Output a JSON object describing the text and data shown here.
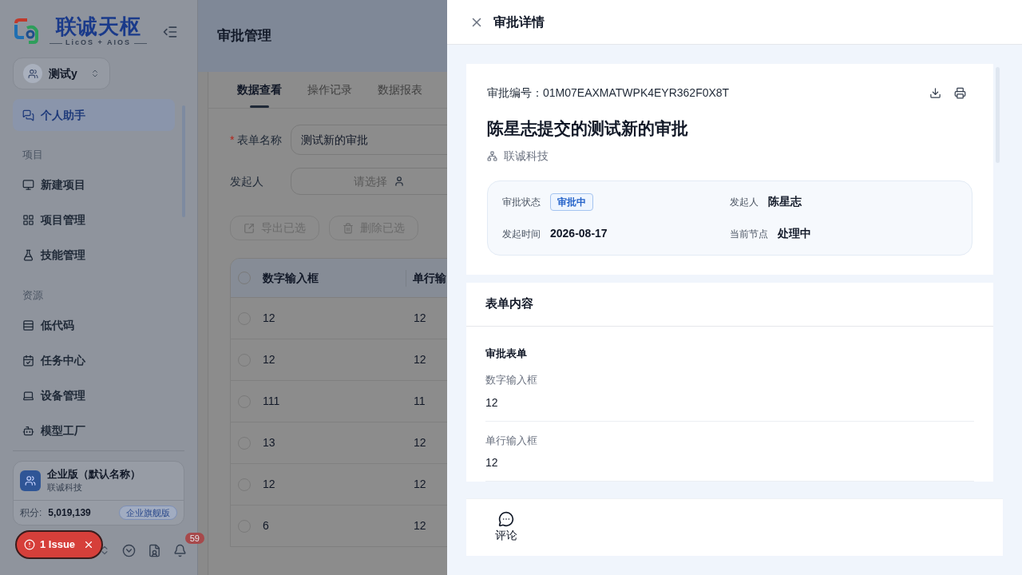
{
  "sidebar": {
    "logo": {
      "name": "联诚天枢",
      "tagline": "LicOS + AIOS"
    },
    "workspace": "测试y",
    "items": [
      {
        "kind": "item",
        "label": "个人助手",
        "selected": true
      },
      {
        "kind": "group",
        "label": "项目"
      },
      {
        "kind": "item",
        "label": "新建项目",
        "selected": false
      },
      {
        "kind": "item",
        "label": "项目管理",
        "selected": false
      },
      {
        "kind": "item",
        "label": "技能管理",
        "selected": false
      },
      {
        "kind": "group",
        "label": "资源"
      },
      {
        "kind": "item",
        "label": "低代码",
        "selected": false
      },
      {
        "kind": "item",
        "label": "任务中心",
        "selected": false
      },
      {
        "kind": "item",
        "label": "设备管理",
        "selected": false
      },
      {
        "kind": "item",
        "label": "模型工厂",
        "selected": false
      }
    ],
    "enterprise": {
      "name": "企业版（默认名称）",
      "company": "联诚科技",
      "points_label": "积分:",
      "points": "5,019,139",
      "plan": "企业旗舰版"
    },
    "notification_count": "59"
  },
  "issue_badge": "1 Issue",
  "page": {
    "title": "审批管理",
    "tabs": [
      {
        "label": "数据查看",
        "selected": true
      },
      {
        "label": "操作记录",
        "selected": false
      },
      {
        "label": "数据报表",
        "selected": false
      }
    ],
    "form_name": {
      "label": "表单名称",
      "required_mark": "*",
      "value": "测试新的审批"
    },
    "initiator": {
      "label": "发起人",
      "placeholder": "请选择"
    },
    "actions": [
      {
        "label": "导出已选",
        "disabled": true
      },
      {
        "label": "删除已选",
        "disabled": true
      }
    ],
    "table": {
      "header_checked": false,
      "columns": [
        "数字输入框",
        "单行输"
      ],
      "rows": [
        {
          "checked": false,
          "cells": [
            "12",
            "12"
          ]
        },
        {
          "checked": false,
          "cells": [
            "12",
            "12"
          ]
        },
        {
          "checked": false,
          "cells": [
            "111",
            "11"
          ]
        },
        {
          "checked": false,
          "cells": [
            "13",
            "12"
          ]
        },
        {
          "checked": false,
          "cells": [
            "12",
            "12"
          ]
        },
        {
          "checked": false,
          "cells": [
            "6",
            "12"
          ]
        }
      ]
    }
  },
  "drawer": {
    "title": "审批详情",
    "number_label": "审批编号：",
    "number": "01M07EAXMATWPK4EYR362F0X8T",
    "heading": "陈星志提交的测试新的审批",
    "org": "联诚科技",
    "info": [
      {
        "label": "审批状态",
        "value": "审批中",
        "kind": "tag"
      },
      {
        "label": "发起人",
        "value": "陈星志",
        "kind": "text"
      },
      {
        "label": "发起时间",
        "value": "2026-08-17",
        "kind": "text"
      },
      {
        "label": "当前节点",
        "value": "处理中",
        "kind": "text"
      }
    ],
    "section_title": "表单内容",
    "form_title": "审批表单",
    "fields": [
      {
        "label": "数字输入框",
        "value": "12"
      },
      {
        "label": "单行输入框",
        "value": "12"
      }
    ],
    "footer_action": "评论"
  }
}
